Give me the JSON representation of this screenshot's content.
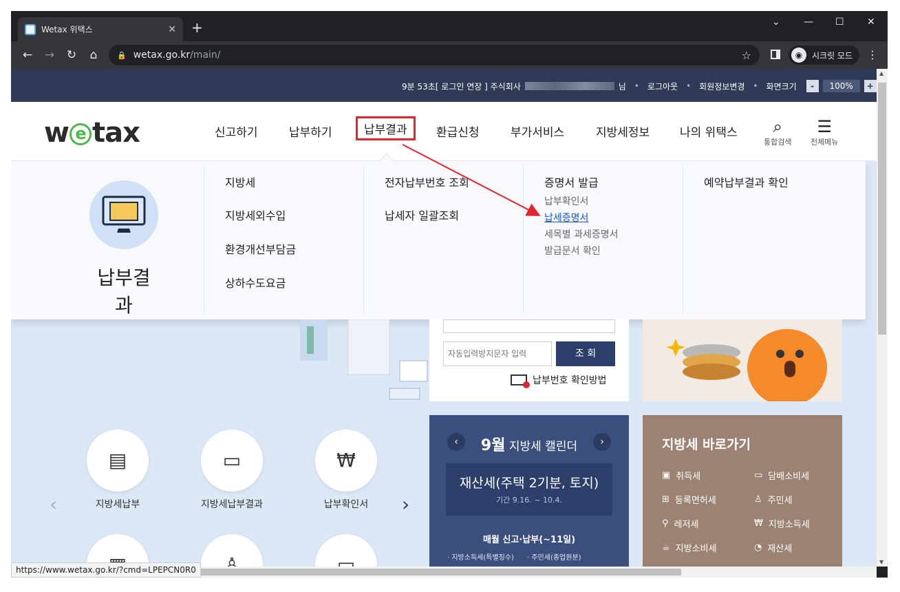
{
  "browser": {
    "tab_title": "Wetax 위택스",
    "url_host": "wetax.go.kr",
    "url_path": "/main/",
    "incognito_label": "시크릿 모드",
    "status_url": "https://www.wetax.go.kr/?cmd=LPEPCN0R0"
  },
  "topbar": {
    "session": "9분 53초[ 로그인 연장 ] 주식회사",
    "user_suffix": "님",
    "logout": "로그아웃",
    "member_edit": "회원정보변경",
    "screen_size": "화면크기",
    "zoom_minus": "-",
    "zoom_value": "100%",
    "zoom_plus": "+"
  },
  "header": {
    "logo_pre": "w",
    "logo_e": "e",
    "logo_post": "tax",
    "nav": [
      "신고하기",
      "납부하기",
      "납부결과",
      "환급신청",
      "부가서비스",
      "지방세정보",
      "나의 위택스"
    ],
    "search_label": "통합검색",
    "menu_label": "전체메뉴"
  },
  "mega": {
    "title": "납부결과",
    "col1": [
      "지방세",
      "지방세외수입",
      "환경개선부담금",
      "상하수도요금"
    ],
    "col2": [
      "전자납부번호 조회",
      "납세자 일괄조회"
    ],
    "col3_head": "증명서 발급",
    "col3_sub": [
      "납부확인서",
      "납세증명서",
      "세목별 과세증명서",
      "발급문서 확인"
    ],
    "col4": [
      "예약납부결과 확인"
    ]
  },
  "content": {
    "captcha_placeholder": "자동입력방지문자 입력",
    "query_btn": "조 회",
    "pay_no_help": "납부번호 확인방법",
    "calendar": {
      "month": "9월",
      "title": "지방세 캘린더",
      "event": "재산세(주택 2기분, 토지)",
      "period": "기간 9.16. ~ 10.4.",
      "monthly": "매월 신고·납부(~11일)",
      "items": [
        "지방소득세(특별징수)",
        "주민세(종업원분)"
      ]
    },
    "quick": {
      "title": "지방세 바로가기",
      "items": [
        "취득세",
        "담배소비세",
        "등록면허세",
        "주민세",
        "레저세",
        "지방소득세",
        "지방소비세",
        "재산세"
      ]
    },
    "shortcuts": [
      "지방세납부",
      "지방세납부결과",
      "납부확인서"
    ]
  }
}
